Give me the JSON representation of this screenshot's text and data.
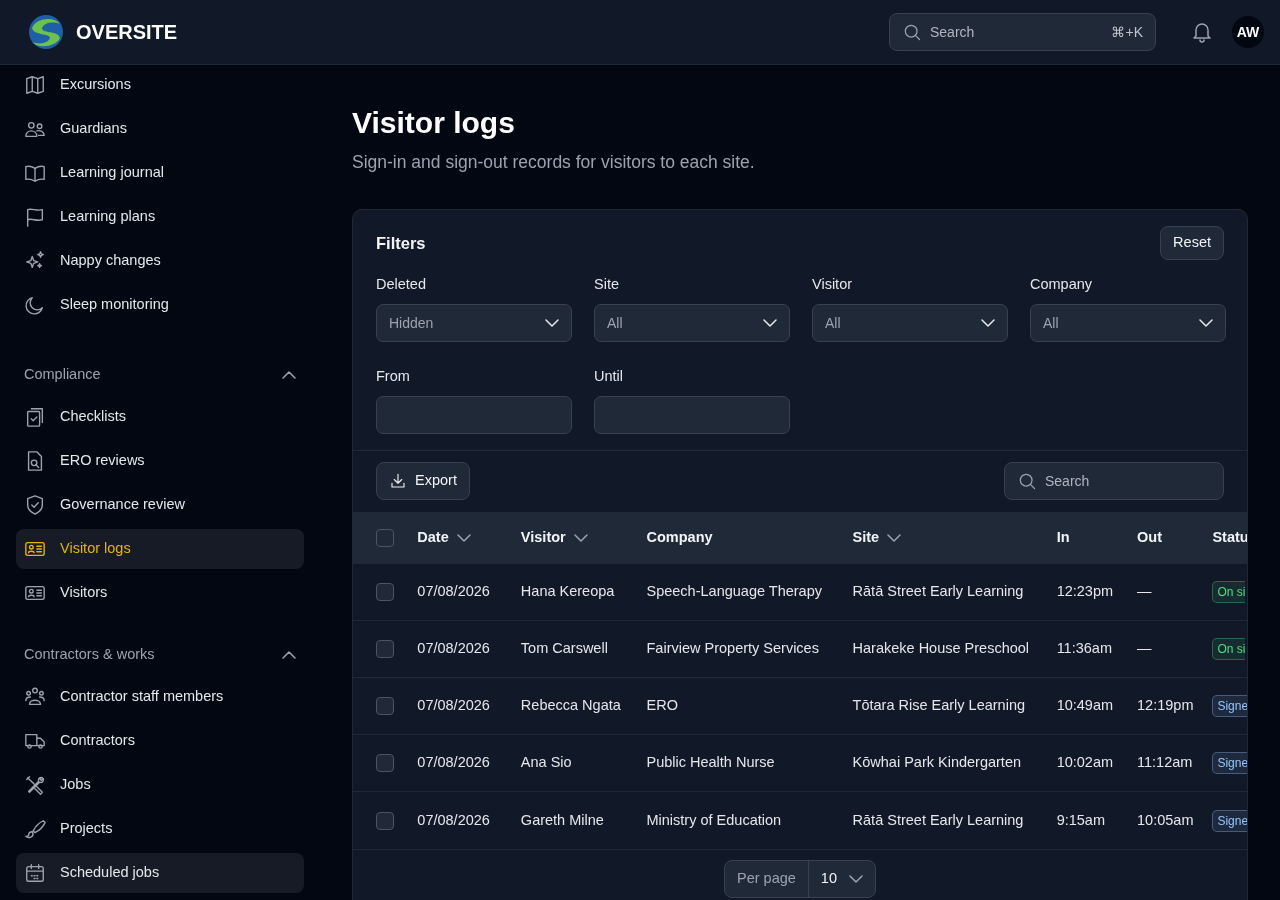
{
  "header": {
    "brand": "OVERSITE",
    "search": {
      "placeholder": "Search",
      "shortcut": "⌘+K"
    },
    "avatar": "AW"
  },
  "sidebar": {
    "sections": [
      {
        "items": [
          {
            "label": "Excursions",
            "selected": false,
            "hovered": false
          },
          {
            "label": "Guardians",
            "selected": false,
            "hovered": false
          },
          {
            "label": "Learning journal",
            "selected": false,
            "hovered": false
          },
          {
            "label": "Learning plans",
            "selected": false,
            "hovered": false
          },
          {
            "label": "Nappy changes",
            "selected": false,
            "hovered": false
          },
          {
            "label": "Sleep monitoring",
            "selected": false,
            "hovered": false
          }
        ]
      },
      {
        "title": "Compliance",
        "expanded": true,
        "items": [
          {
            "label": "Checklists",
            "selected": false,
            "hovered": false
          },
          {
            "label": "ERO reviews",
            "selected": false,
            "hovered": false
          },
          {
            "label": "Governance review",
            "selected": false,
            "hovered": false
          },
          {
            "label": "Visitor logs",
            "selected": true,
            "hovered": false
          },
          {
            "label": "Visitors",
            "selected": false,
            "hovered": false
          }
        ]
      },
      {
        "title": "Contractors & works",
        "expanded": true,
        "items": [
          {
            "label": "Contractor staff members",
            "selected": false,
            "hovered": false
          },
          {
            "label": "Contractors",
            "selected": false,
            "hovered": false
          },
          {
            "label": "Jobs",
            "selected": false,
            "hovered": false
          },
          {
            "label": "Projects",
            "selected": false,
            "hovered": false
          },
          {
            "label": "Scheduled jobs",
            "selected": false,
            "hovered": true
          }
        ]
      }
    ]
  },
  "page": {
    "title": "Visitor logs",
    "subtitle": "Sign-in and sign-out records for visitors to each site."
  },
  "filters": {
    "title": "Filters",
    "reset": "Reset",
    "fields": [
      {
        "label": "Deleted",
        "kind": "select",
        "value": "Hidden"
      },
      {
        "label": "Site",
        "kind": "select",
        "value": "All"
      },
      {
        "label": "Visitor",
        "kind": "select",
        "value": "All"
      },
      {
        "label": "Company",
        "kind": "select",
        "value": "All"
      },
      {
        "label": "From",
        "kind": "date"
      },
      {
        "label": "Until",
        "kind": "date"
      }
    ]
  },
  "toolbar": {
    "export": "Export",
    "search": {
      "placeholder": "Search"
    }
  },
  "table": {
    "all_checked": false,
    "columns": [
      {
        "label": "Date",
        "sortable": true
      },
      {
        "label": "Visitor",
        "sortable": true
      },
      {
        "label": "Company",
        "sortable": false
      },
      {
        "label": "Site",
        "sortable": true
      },
      {
        "label": "In",
        "sortable": false
      },
      {
        "label": "Out",
        "sortable": false
      },
      {
        "label": "Statu",
        "sortable": false
      }
    ],
    "rows": [
      {
        "checked": false,
        "cells": [
          "07/08/2026",
          "Hana Kereopa",
          "Speech-Language Therapy",
          "Rātā Street Early Learning",
          "12:23pm",
          "—"
        ],
        "status": {
          "label": "On si",
          "color": "#4ade80"
        }
      },
      {
        "checked": false,
        "cells": [
          "07/08/2026",
          "Tom Carswell",
          "Fairview Property Services",
          "Harakeke House Preschool",
          "11:36am",
          "—"
        ],
        "status": {
          "label": "On si",
          "color": "#4ade80"
        }
      },
      {
        "checked": false,
        "cells": [
          "07/08/2026",
          "Rebecca Ngata",
          "ERO",
          "Tōtara Rise Early Learning",
          "10:49am",
          "12:19pm"
        ],
        "status": {
          "label": "Signe",
          "color": "#93c5fd"
        }
      },
      {
        "checked": false,
        "cells": [
          "07/08/2026",
          "Ana Sio",
          "Public Health Nurse",
          "Kōwhai Park Kindergarten",
          "10:02am",
          "11:12am"
        ],
        "status": {
          "label": "Signe",
          "color": "#93c5fd"
        }
      },
      {
        "checked": false,
        "cells": [
          "07/08/2026",
          "Gareth Milne",
          "Ministry of Education",
          "Rātā Street Early Learning",
          "9:15am",
          "10:05am"
        ],
        "status": {
          "label": "Signe",
          "color": "#93c5fd"
        }
      }
    ]
  },
  "pagination": {
    "label": "Per page",
    "value": "10"
  }
}
